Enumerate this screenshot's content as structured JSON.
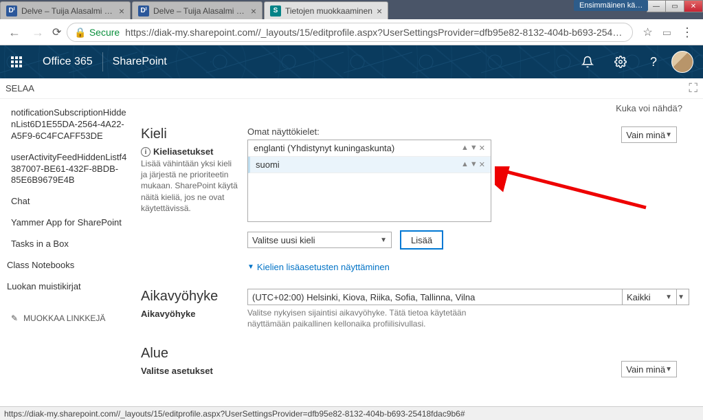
{
  "browser": {
    "tabs": [
      {
        "icon": "Dⁱ",
        "label": "Delve – Tuija Alasalmi – e…"
      },
      {
        "icon": "Dⁱ",
        "label": "Delve – Tuija Alasalmi – e…"
      },
      {
        "icon": "S",
        "label": "Tietojen muokkaaminen"
      }
    ],
    "toolbar_pill": "Ensimmäinen kä…",
    "secure_label": "Secure",
    "url": "https://diak-my.sharepoint.com//_layouts/15/editprofile.aspx?UserSettingsProvider=dfb95e82-8132-404b-b693-25418fd…"
  },
  "o365": {
    "brand": "Office 365",
    "title": "SharePoint"
  },
  "ribbon": {
    "tab": "SELAA"
  },
  "sidebar": {
    "items": [
      "notificationSubscriptionHiddenList6D1E55DA-2564-4A22-A5F9-6C4FCAFF53DE",
      "userActivityFeedHiddenListf4387007-BE61-432F-8BDB-85E6B9679E4B",
      "Chat",
      "Yammer App for SharePoint",
      "Tasks in a Box"
    ],
    "extra1": "Class Notebooks",
    "extra2": "Luokan muistikirjat",
    "edit": "MUOKKAA LINKKEJÄ"
  },
  "main": {
    "who_sees": "Kuka voi nähdä?",
    "lang": {
      "section_title": "Kieli",
      "sub_label": "Kieliasetukset",
      "sub_desc": "Lisää vähintään yksi kieli ja järjestä ne prioriteetin mukaan. SharePoint käytä näitä kieliä, jos ne ovat käytettävissä.",
      "field_label": "Omat näyttökielet:",
      "langs": [
        "englanti (Yhdistynyt kuningaskunta)",
        "suomi"
      ],
      "select_placeholder": "Valitse uusi kieli",
      "add_btn": "Lisää",
      "more_link": "Kielien lisäasetusten näyttäminen",
      "visibility": "Vain minä"
    },
    "tz": {
      "section_title": "Aikavyöhyke",
      "sub_label": "Aikavyöhyke",
      "value": "(UTC+02:00) Helsinki, Kiova, Riika, Sofia, Tallinna, Vilna",
      "help": "Valitse nykyisen sijaintisi aikavyöhyke. Tätä tietoa käytetään näyttämään paikallinen kellonaika profiilisivullasi.",
      "visibility": "Kaikki"
    },
    "region": {
      "section_title": "Alue",
      "sub_label": "Valitse asetukset",
      "visibility": "Vain minä"
    }
  },
  "status_url": "https://diak-my.sharepoint.com//_layouts/15/editprofile.aspx?UserSettingsProvider=dfb95e82-8132-404b-b693-25418fdac9b6#"
}
